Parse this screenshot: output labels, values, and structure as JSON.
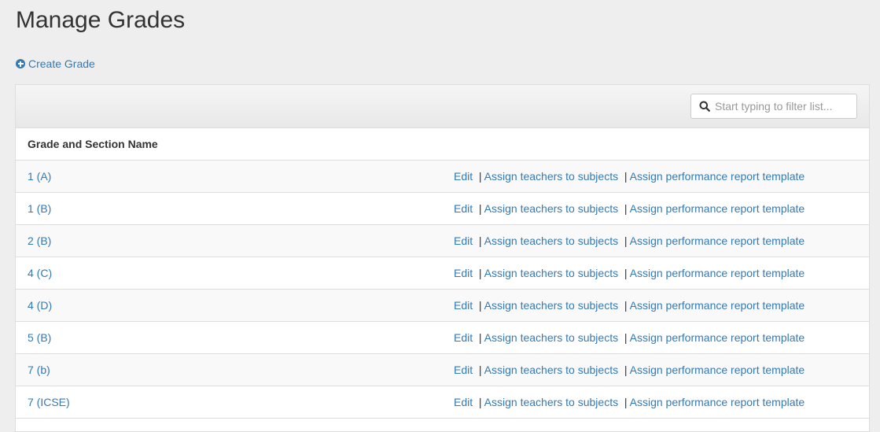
{
  "page": {
    "title": "Manage Grades",
    "create_label": "Create Grade"
  },
  "filter": {
    "placeholder": "Start typing to filter list..."
  },
  "table": {
    "column_header": "Grade and Section Name",
    "actions": {
      "edit": "Edit",
      "assign_teachers": "Assign teachers to subjects",
      "assign_report": "Assign performance report template",
      "separator": "|"
    },
    "rows": [
      {
        "name": "1 (A)"
      },
      {
        "name": "1 (B)"
      },
      {
        "name": "2 (B)"
      },
      {
        "name": "4 (C)"
      },
      {
        "name": "4 (D)"
      },
      {
        "name": "5 (B)"
      },
      {
        "name": "7 (b)"
      },
      {
        "name": "7 (ICSE)"
      }
    ]
  },
  "colors": {
    "link": "#337ab7",
    "background": "#eeeeee"
  }
}
